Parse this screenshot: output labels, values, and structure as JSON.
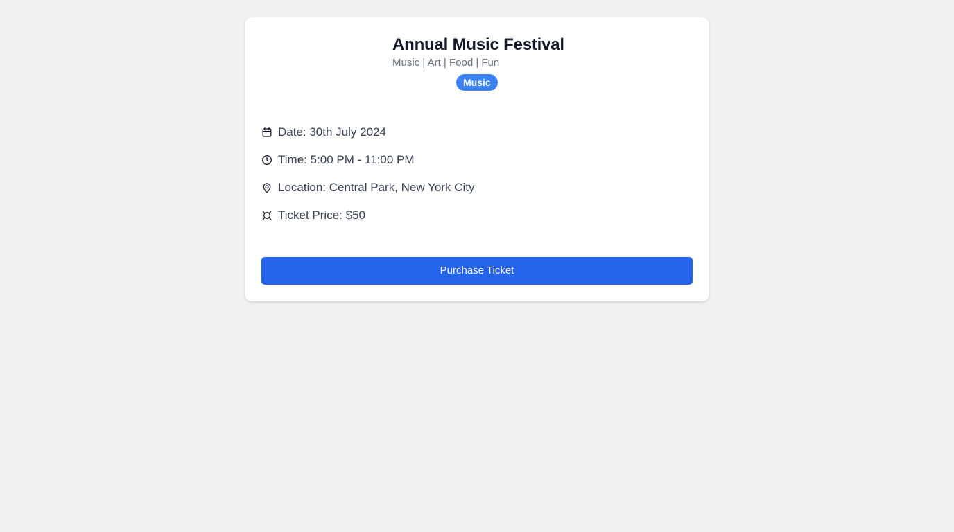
{
  "event": {
    "title": "Annual Music Festival",
    "subtitle": "Music | Art | Food | Fun",
    "category_badge": "Music"
  },
  "details": [
    {
      "icon": "calendar-icon",
      "text": "Date: 30th July 2024"
    },
    {
      "icon": "clock-icon",
      "text": "Time: 5:00 PM - 11:00 PM"
    },
    {
      "icon": "location-pin-icon",
      "text": "Location: Central Park, New York City"
    },
    {
      "icon": "currency-icon",
      "text": "Ticket Price: $50"
    }
  ],
  "actions": {
    "purchase_label": "Purchase Ticket"
  },
  "colors": {
    "page_background": "#f1f1f1",
    "card_background": "#ffffff",
    "badge": "#3b82f6",
    "primary_button": "#2563eb",
    "title_text": "#111827",
    "muted_text": "#6b7280"
  }
}
